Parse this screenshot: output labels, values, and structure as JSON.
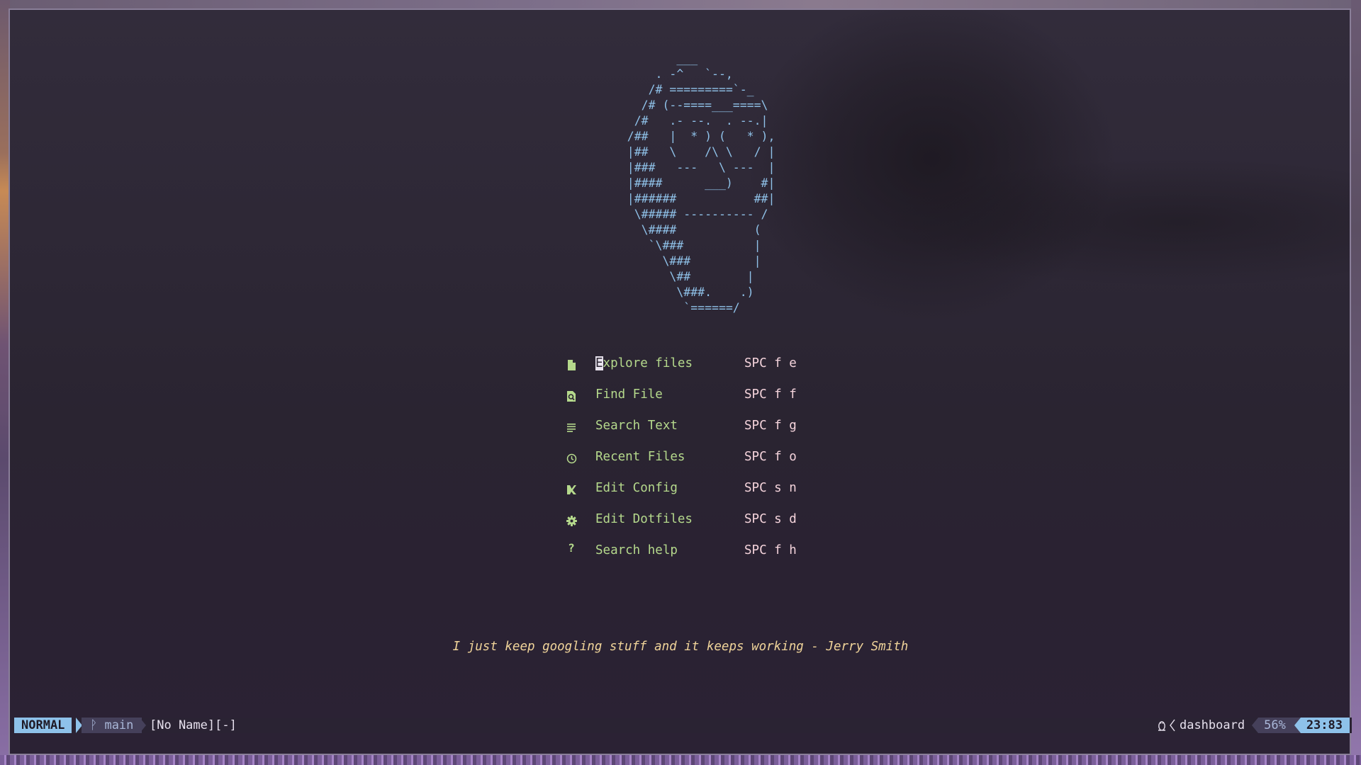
{
  "ascii_art": "          ___\n       . -^   `--,\n      /# =========`-_\n     /# (--====___====\\\n    /#   .- --.  . --.|\n   /##   |  * ) (   * ),\n   |##   \\    /\\ \\   / |\n   |###   ---   \\ ---  |\n   |####      ___)    #|\n   |######           ##|\n    \\##### ---------- /\n     \\####           (\n      `\\###          |\n        \\###         |\n         \\##        |\n          \\###.    .)\n           `======/",
  "menu": {
    "items": [
      {
        "icon": "file-icon",
        "label": "Explore files",
        "shortcut": "SPC f e"
      },
      {
        "icon": "find-file-icon",
        "label": "Find File",
        "shortcut": "SPC f f"
      },
      {
        "icon": "text-lines-icon",
        "label": "Search Text",
        "shortcut": "SPC f g"
      },
      {
        "icon": "clock-icon",
        "label": "Recent Files",
        "shortcut": "SPC f o"
      },
      {
        "icon": "edit-config-icon",
        "label": "Edit Config",
        "shortcut": "SPC s n"
      },
      {
        "icon": "gear-icon",
        "label": "Edit Dotfiles",
        "shortcut": "SPC s d"
      },
      {
        "icon": "question-icon",
        "label": "Search help",
        "shortcut": "SPC f h"
      }
    ]
  },
  "quote": "I just keep googling stuff and it keeps working - Jerry Smith",
  "statusline": {
    "mode": "NORMAL",
    "branch_icon": "ᚹ",
    "branch": "main",
    "filename": "[No Name][-]",
    "os_icon": "linux-penguin-icon",
    "filetype": "dashboard",
    "percent": "56%",
    "time": "23:83"
  },
  "colors": {
    "menu_text": "#b5d98c",
    "shortcut_text": "#f5d4dc",
    "ascii_art": "#8fc1e8",
    "quote": "#f0d49a",
    "mode_bg": "#8ec2ea"
  }
}
